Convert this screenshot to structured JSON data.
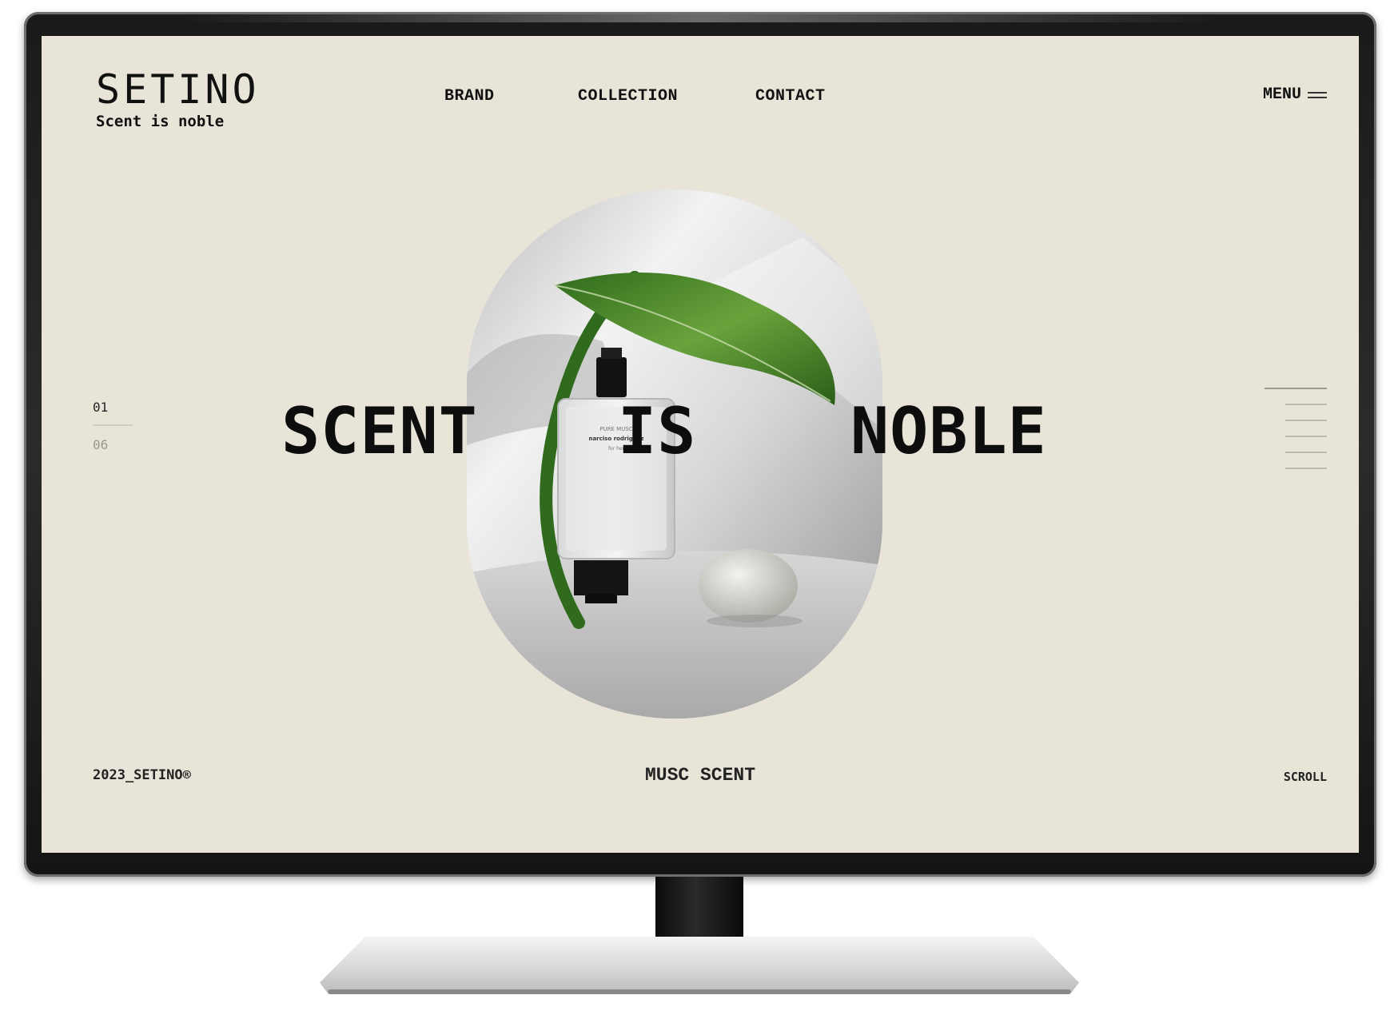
{
  "brand": {
    "name": "SETINO",
    "tagline": "Scent is noble"
  },
  "nav": {
    "items": [
      {
        "label": "BRAND"
      },
      {
        "label": "COLLECTION"
      },
      {
        "label": "CONTACT"
      }
    ],
    "menu_label": "MENU",
    "menu_icon": "hamburger-icon"
  },
  "hero": {
    "words": [
      "SCENT",
      "IS",
      "NOBLE"
    ],
    "image": {
      "bottle_label_line1": "PURE MUSC",
      "bottle_label_line2": "narciso rodriguez",
      "bottle_label_line3": "for her"
    }
  },
  "slider": {
    "current": "01",
    "total": "06"
  },
  "footer": {
    "copyright": "2023_SETINO®",
    "product": "MUSC SCENT",
    "scroll_label": "SCROLL"
  },
  "colors": {
    "background": "#e8e5d8",
    "text": "#111111",
    "leaf": "#3f7d2a",
    "bezel": "#1a1a1a"
  }
}
